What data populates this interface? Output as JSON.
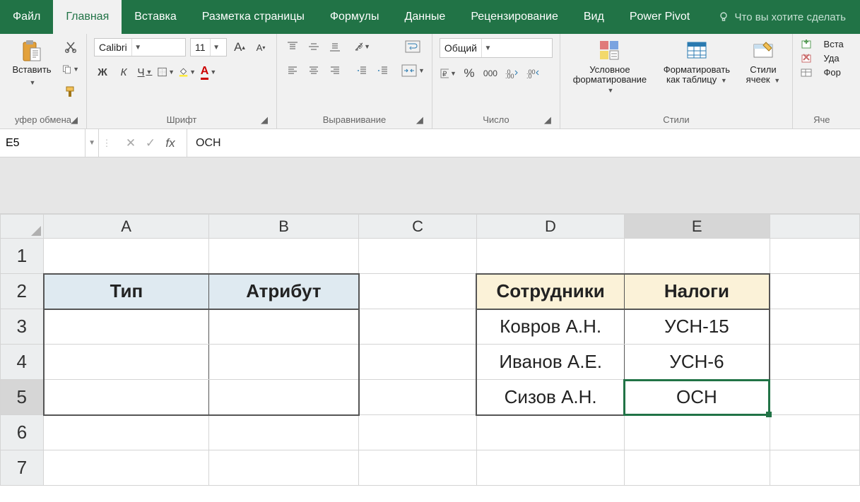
{
  "tabs": {
    "file": "Файл",
    "home": "Главная",
    "insert": "Вставка",
    "page_layout": "Разметка страницы",
    "formulas": "Формулы",
    "data": "Данные",
    "review": "Рецензирование",
    "view": "Вид",
    "power_pivot": "Power Pivot"
  },
  "tell_me": "Что вы хотите сделать",
  "ribbon": {
    "clipboard": {
      "label": "уфер обмена",
      "paste": "Вставить"
    },
    "font": {
      "label": "Шрифт",
      "name": "Calibri",
      "size": "11",
      "bold": "Ж",
      "italic": "К",
      "underline": "Ч"
    },
    "alignment": {
      "label": "Выравнивание"
    },
    "number": {
      "label": "Число",
      "format": "Общий",
      "percent": "%",
      "thousands": "000"
    },
    "styles": {
      "label": "Стили",
      "cond_fmt1": "Условное",
      "cond_fmt2": "форматирование",
      "as_table1": "Форматировать",
      "as_table2": "как таблицу",
      "cell_styles1": "Стили",
      "cell_styles2": "ячеек"
    },
    "cells": {
      "label": "Яче",
      "insert": "Вста",
      "delete": "Уда",
      "format": "Фор"
    }
  },
  "namebox": "E5",
  "formula": "ОСН",
  "fx_label": "fx",
  "columns": [
    "A",
    "B",
    "C",
    "D",
    "E"
  ],
  "rows": [
    "1",
    "2",
    "3",
    "4",
    "5",
    "6",
    "7"
  ],
  "sheet": {
    "A2": "Тип",
    "B2": "Атрибут",
    "D2": "Сотрудники",
    "E2": "Налоги",
    "D3": "Ковров А.Н.",
    "E3": "УСН-15",
    "D4": "Иванов А.Е.",
    "E4": "УСН-6",
    "D5": "Сизов А.Н.",
    "E5": "ОСН"
  }
}
